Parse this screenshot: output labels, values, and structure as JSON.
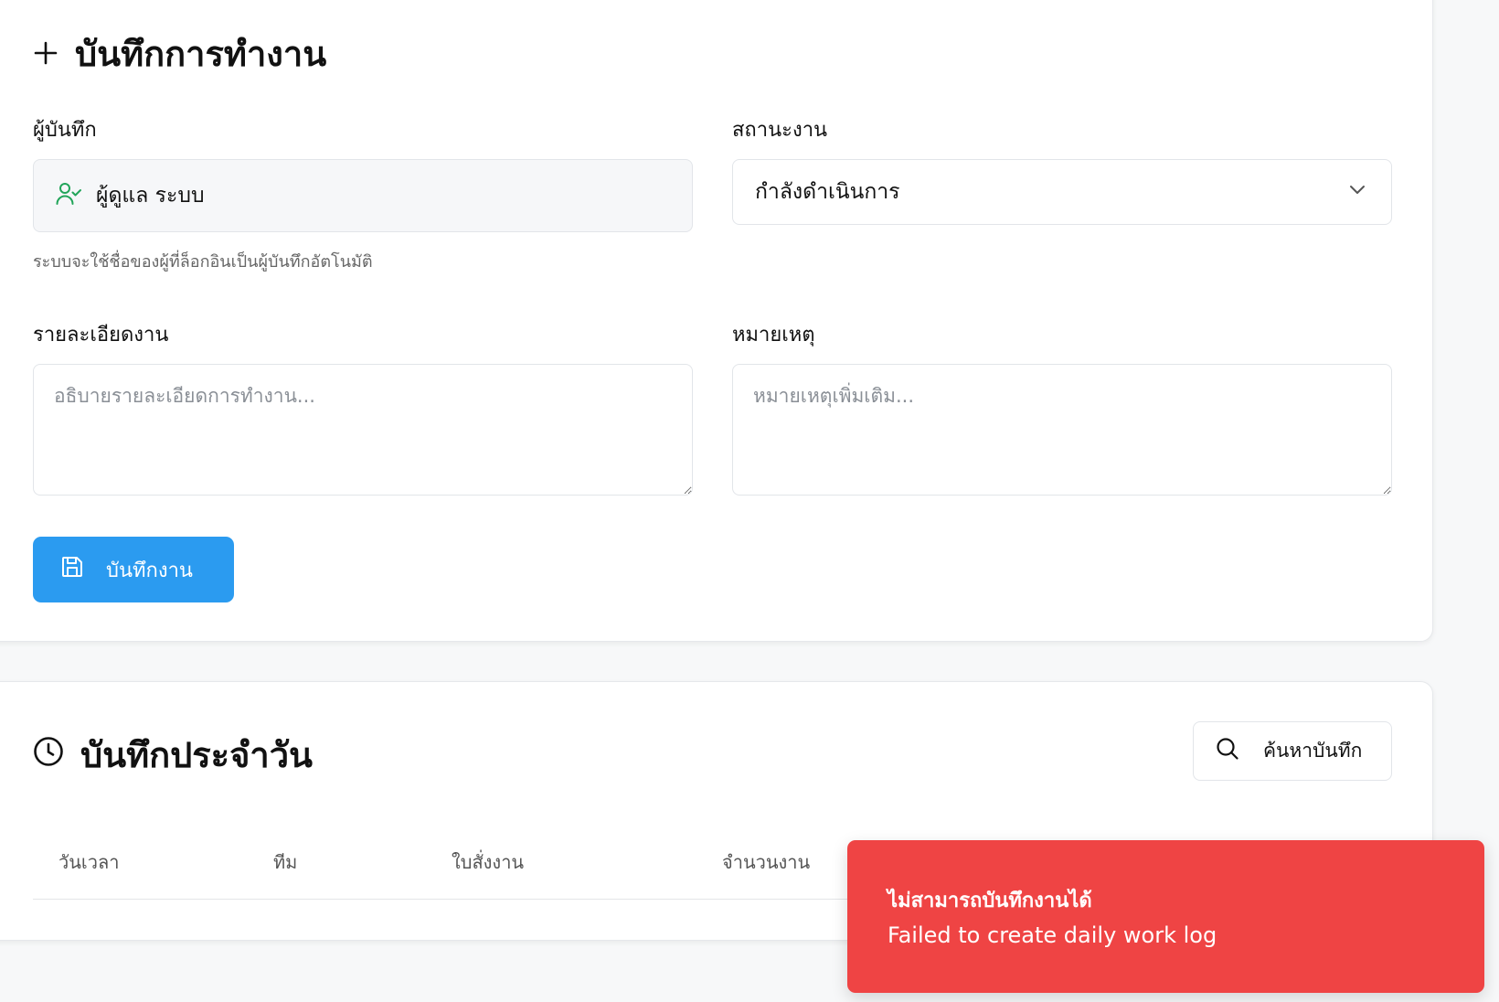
{
  "form": {
    "title": "บันทึกการทำงาน",
    "recorder_label": "ผู้บันทึก",
    "recorder_value": "ผู้ดูแล ระบบ",
    "recorder_hint": "ระบบจะใช้ชื่อของผู้ที่ล็อกอินเป็นผู้บันทึกอัตโนมัติ",
    "status_label": "สถานะงาน",
    "status_value": "กำลังดำเนินการ",
    "details_label": "รายละเอียดงาน",
    "details_placeholder": "อธิบายรายละเอียดการทำงาน...",
    "notes_label": "หมายเหตุ",
    "notes_placeholder": "หมายเหตุเพิ่มเติม...",
    "save_label": "บันทึกงาน"
  },
  "log": {
    "title": "บันทึกประจำวัน",
    "search_label": "ค้นหาบันทึก",
    "columns": [
      "วันเวลา",
      "ทีม",
      "ใบสั่งงาน",
      "จำนวนงาน"
    ]
  },
  "toast": {
    "title": "ไม่สามารถบันทึกงานได้",
    "message": "Failed to create daily work log"
  },
  "colors": {
    "primary": "#2b9bf0",
    "error": "#ef4444",
    "user_icon": "#22a55a"
  },
  "icons": {
    "title": "plus-icon",
    "recorder": "user-check-icon",
    "status": "chevron-down-icon",
    "save": "save-icon",
    "log_title": "clock-icon",
    "search": "search-icon"
  }
}
